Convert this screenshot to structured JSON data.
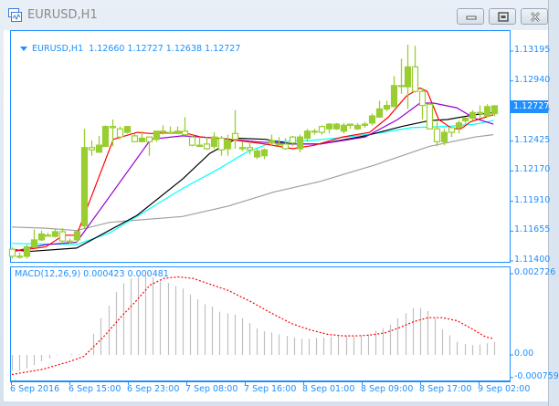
{
  "window": {
    "title": "EURUSD,H1",
    "buttons": [
      "minimize",
      "restore",
      "close"
    ]
  },
  "header": {
    "symbol": "EURUSD,H1",
    "ohlc": "1.12660 1.12727 1.12638 1.12727"
  },
  "colors": {
    "accent": "#1e90ff",
    "candle": "#9acd32",
    "ma_red": "#ff0000",
    "ma_purple": "#9400d3",
    "ma_black": "#000000",
    "ma_cyan": "#00ffff",
    "ma_gray": "#a0a0a0",
    "macd_hist": "#c0c0c0",
    "macd_signal": "#ff0000"
  },
  "chart_data": [
    {
      "type": "candlestick",
      "title": "EURUSD,H1",
      "ylim": [
        1.114,
        1.13195
      ],
      "y_ticks": [
        "1.13195",
        "1.12940",
        "1.12685",
        "1.12425",
        "1.12170",
        "1.11910",
        "1.11655",
        "1.11400"
      ],
      "current_price": "1.12727",
      "x_ticks": [
        "6 Sep 2016",
        "6 Sep 15:00",
        "6 Sep 23:00",
        "7 Sep 08:00",
        "7 Sep 16:00",
        "8 Sep 01:00",
        "8 Sep 09:00",
        "8 Sep 17:00",
        "9 Sep 02:00"
      ],
      "ohlc": [
        [
          1.115,
          1.1152,
          1.1142,
          1.1144
        ],
        [
          1.1144,
          1.1147,
          1.1142,
          1.1144
        ],
        [
          1.1144,
          1.1154,
          1.1142,
          1.1152
        ],
        [
          1.1152,
          1.1167,
          1.1151,
          1.1158
        ],
        [
          1.1158,
          1.1166,
          1.1157,
          1.1163
        ],
        [
          1.1162,
          1.1164,
          1.1161,
          1.1162
        ],
        [
          1.1161,
          1.1167,
          1.116,
          1.1165
        ],
        [
          1.1165,
          1.1168,
          1.1155,
          1.1157
        ],
        [
          1.1157,
          1.1159,
          1.1155,
          1.1157
        ],
        [
          1.1158,
          1.1166,
          1.1156,
          1.1165
        ],
        [
          1.117,
          1.1253,
          1.1168,
          1.1237
        ],
        [
          1.1237,
          1.1243,
          1.123,
          1.1235
        ],
        [
          1.1233,
          1.1247,
          1.1233,
          1.1239
        ],
        [
          1.1238,
          1.1256,
          1.1238,
          1.1255
        ],
        [
          1.1255,
          1.1261,
          1.1238,
          1.1254
        ],
        [
          1.1253,
          1.1255,
          1.1244,
          1.1246
        ],
        [
          1.125,
          1.1255,
          1.1249,
          1.1255
        ],
        [
          1.1247,
          1.1249,
          1.1242,
          1.1242
        ],
        [
          1.1242,
          1.1251,
          1.1242,
          1.1245
        ],
        [
          1.1246,
          1.1246,
          1.123,
          1.1242
        ],
        [
          1.1244,
          1.1251,
          1.1242,
          1.1251
        ],
        [
          1.125,
          1.1256,
          1.1248,
          1.1251
        ],
        [
          1.125,
          1.1255,
          1.1249,
          1.1249
        ],
        [
          1.1249,
          1.1255,
          1.1249,
          1.1251
        ],
        [
          1.1251,
          1.1263,
          1.1248,
          1.1248
        ],
        [
          1.1246,
          1.1247,
          1.1238,
          1.1239
        ],
        [
          1.1238,
          1.1246,
          1.1238,
          1.1239
        ],
        [
          1.124,
          1.1246,
          1.1235,
          1.1236
        ],
        [
          1.1238,
          1.125,
          1.1236,
          1.1246
        ],
        [
          1.1245,
          1.1247,
          1.123,
          1.1235
        ],
        [
          1.1236,
          1.1248,
          1.123,
          1.1243
        ],
        [
          1.1249,
          1.1269,
          1.1236,
          1.1244
        ],
        [
          1.1237,
          1.1242,
          1.1234,
          1.1236
        ],
        [
          1.1237,
          1.1242,
          1.1231,
          1.1235
        ],
        [
          1.1229,
          1.1236,
          1.1227,
          1.1234
        ],
        [
          1.123,
          1.1236,
          1.1227,
          1.1235
        ],
        [
          1.1241,
          1.1248,
          1.1238,
          1.1243
        ],
        [
          1.124,
          1.1246,
          1.1238,
          1.124
        ],
        [
          1.124,
          1.1245,
          1.1235,
          1.1236
        ],
        [
          1.1246,
          1.1247,
          1.1238,
          1.1241
        ],
        [
          1.1236,
          1.1248,
          1.1233,
          1.1246
        ],
        [
          1.1245,
          1.1253,
          1.1242,
          1.1251
        ],
        [
          1.1251,
          1.1253,
          1.1248,
          1.1251
        ],
        [
          1.1255,
          1.1256,
          1.1248,
          1.125
        ],
        [
          1.1253,
          1.1258,
          1.1249,
          1.1257
        ],
        [
          1.1253,
          1.1258,
          1.1252,
          1.1257
        ],
        [
          1.1251,
          1.1258,
          1.1249,
          1.1256
        ],
        [
          1.1257,
          1.1257,
          1.1253,
          1.1256
        ],
        [
          1.1253,
          1.1258,
          1.1252,
          1.1256
        ],
        [
          1.1256,
          1.1259,
          1.1254,
          1.1257
        ],
        [
          1.1258,
          1.1266,
          1.1256,
          1.1264
        ],
        [
          1.1263,
          1.1277,
          1.1263,
          1.127
        ],
        [
          1.127,
          1.1277,
          1.1268,
          1.1273
        ],
        [
          1.1272,
          1.1298,
          1.1272,
          1.129
        ],
        [
          1.129,
          1.1313,
          1.1283,
          1.129
        ],
        [
          1.1289,
          1.1325,
          1.127,
          1.1306
        ],
        [
          1.1306,
          1.1324,
          1.1284,
          1.1285
        ],
        [
          1.1285,
          1.1288,
          1.1261,
          1.1273
        ],
        [
          1.1274,
          1.1275,
          1.1253,
          1.1253
        ],
        [
          1.1253,
          1.1259,
          1.1238,
          1.1242
        ],
        [
          1.1242,
          1.1253,
          1.1239,
          1.125
        ],
        [
          1.1254,
          1.1255,
          1.1246,
          1.125
        ],
        [
          1.1254,
          1.126,
          1.1249,
          1.1258
        ],
        [
          1.126,
          1.1263,
          1.1257,
          1.1262
        ],
        [
          1.1262,
          1.1269,
          1.126,
          1.1267
        ],
        [
          1.1267,
          1.1273,
          1.1262,
          1.1266
        ],
        [
          1.1264,
          1.1274,
          1.1263,
          1.1272
        ],
        [
          1.1266,
          1.12727,
          1.12638,
          1.12727
        ]
      ],
      "moving_averages": [
        {
          "name": "ma-red",
          "color_key": "ma_red",
          "points": [
            [
              0,
              1.1148
            ],
            [
              4.7,
              1.1152
            ],
            [
              7.2,
              1.1162
            ],
            [
              9,
              1.1162
            ],
            [
              14.1,
              1.1244
            ],
            [
              17.4,
              1.125
            ],
            [
              19.3,
              1.1249
            ],
            [
              23.7,
              1.125
            ],
            [
              26.3,
              1.1246
            ],
            [
              30.1,
              1.1244
            ],
            [
              35.2,
              1.124
            ],
            [
              39,
              1.1236
            ],
            [
              42.1,
              1.1239
            ],
            [
              45.9,
              1.1246
            ],
            [
              49.7,
              1.125
            ],
            [
              52.3,
              1.1263
            ],
            [
              54.8,
              1.1281
            ],
            [
              56.7,
              1.1288
            ],
            [
              57.7,
              1.1285
            ],
            [
              59.3,
              1.1261
            ],
            [
              61.2,
              1.1253
            ],
            [
              62.4,
              1.1253
            ],
            [
              63.7,
              1.1259
            ],
            [
              66.9,
              1.1265
            ]
          ]
        },
        {
          "name": "ma-purple",
          "color_key": "ma_purple",
          "points": [
            [
              0,
              1.1148
            ],
            [
              4.7,
              1.1154
            ],
            [
              9,
              1.1156
            ],
            [
              19.3,
              1.1244
            ],
            [
              23.7,
              1.1247
            ],
            [
              28.8,
              1.1245
            ],
            [
              33.9,
              1.1242
            ],
            [
              39,
              1.124
            ],
            [
              42.8,
              1.124
            ],
            [
              49.1,
              1.1246
            ],
            [
              53.6,
              1.1261
            ],
            [
              56.7,
              1.1275
            ],
            [
              58.6,
              1.1275
            ],
            [
              61.8,
              1.1271
            ],
            [
              64.3,
              1.1262
            ],
            [
              66.9,
              1.1257
            ]
          ]
        },
        {
          "name": "ma-black",
          "color_key": "ma_black",
          "points": [
            [
              0,
              1.115
            ],
            [
              2.2,
              1.1148
            ],
            [
              9,
              1.1151
            ],
            [
              17.4,
              1.1179
            ],
            [
              23.7,
              1.121
            ],
            [
              27.5,
              1.1232
            ],
            [
              31.3,
              1.1245
            ],
            [
              35.2,
              1.1244
            ],
            [
              39,
              1.124
            ],
            [
              42.8,
              1.124
            ],
            [
              49.1,
              1.1247
            ],
            [
              54.2,
              1.1255
            ],
            [
              58,
              1.126
            ],
            [
              60.5,
              1.1261
            ],
            [
              64.3,
              1.1265
            ],
            [
              66.9,
              1.1267
            ]
          ]
        },
        {
          "name": "ma-cyan",
          "color_key": "ma_cyan",
          "points": [
            [
              0,
              1.1155
            ],
            [
              9,
              1.1154
            ],
            [
              13.6,
              1.1164
            ],
            [
              18.7,
              1.1183
            ],
            [
              23.7,
              1.1202
            ],
            [
              28.8,
              1.1219
            ],
            [
              32.6,
              1.1233
            ],
            [
              36.4,
              1.1242
            ],
            [
              41.5,
              1.1243
            ],
            [
              46.6,
              1.1246
            ],
            [
              51.6,
              1.125
            ],
            [
              55.5,
              1.1254
            ],
            [
              60.5,
              1.1255
            ],
            [
              64.3,
              1.1257
            ],
            [
              66.9,
              1.126
            ]
          ]
        },
        {
          "name": "ma-gray",
          "color_key": "ma_gray",
          "points": [
            [
              0,
              1.1169
            ],
            [
              4.7,
              1.1168
            ],
            [
              9,
              1.1166
            ],
            [
              13.6,
              1.1173
            ],
            [
              23.7,
              1.1178
            ],
            [
              30.1,
              1.1187
            ],
            [
              36.4,
              1.1199
            ],
            [
              42.8,
              1.1208
            ],
            [
              50.4,
              1.1222
            ],
            [
              54.2,
              1.123
            ],
            [
              58,
              1.1238
            ],
            [
              64.3,
              1.1246
            ],
            [
              66.9,
              1.1248
            ]
          ]
        }
      ]
    },
    {
      "type": "bar",
      "title": "MACD(12,26,9) 0.000423 0.000481",
      "ylim": [
        -0.000759,
        0.002726
      ],
      "y_ticks": [
        "0.002726",
        "0.00",
        "-0.000759"
      ],
      "histogram": [
        -0.00053,
        -0.00053,
        -0.00045,
        -0.00034,
        -0.00022,
        -0.00012,
        -2e-05,
        0,
        3e-05,
        3e-05,
        6e-05,
        0.00071,
        0.00123,
        0.00165,
        0.00211,
        0.00241,
        0.00257,
        0.00262,
        0.00264,
        0.0026,
        0.00246,
        0.00241,
        0.00231,
        0.00223,
        0.00203,
        0.00186,
        0.0017,
        0.00162,
        0.00145,
        0.0014,
        0.00135,
        0.00123,
        0.00107,
        0.00089,
        0.00079,
        0.00076,
        0.00069,
        0.00064,
        0.00059,
        0.00054,
        0.00054,
        0.00057,
        0.00059,
        0.00061,
        0.00064,
        0.00064,
        0.00061,
        0.00064,
        0.00069,
        0.00081,
        0.00089,
        0.00101,
        0.00123,
        0.0014,
        0.00158,
        0.00158,
        0.00147,
        0.00123,
        0.00086,
        0.00066,
        0.00044,
        0.00037,
        0.00033,
        0.00035,
        0.00039,
        0.00044
      ],
      "signal": [
        [
          0,
          -0.00066
        ],
        [
          4.2,
          -0.00048
        ],
        [
          7.8,
          -0.00022
        ],
        [
          9.7,
          -5e-05
        ],
        [
          12.3,
          0.00059
        ],
        [
          14.8,
          0.0013
        ],
        [
          16.7,
          0.0018
        ],
        [
          18.6,
          0.00234
        ],
        [
          20.5,
          0.00257
        ],
        [
          22.4,
          0.00262
        ],
        [
          24.4,
          0.00257
        ],
        [
          26.3,
          0.00241
        ],
        [
          29.2,
          0.00216
        ],
        [
          32.1,
          0.0018
        ],
        [
          35,
          0.0014
        ],
        [
          37.8,
          0.00104
        ],
        [
          40.2,
          0.00084
        ],
        [
          42.6,
          0.00069
        ],
        [
          44.6,
          0.00064
        ],
        [
          46.5,
          0.00064
        ],
        [
          48.4,
          0.00067
        ],
        [
          50.3,
          0.00074
        ],
        [
          52.3,
          0.00092
        ],
        [
          54.2,
          0.00112
        ],
        [
          56.1,
          0.00125
        ],
        [
          58,
          0.00125
        ],
        [
          60,
          0.00115
        ],
        [
          61.9,
          0.00089
        ],
        [
          63.8,
          0.00061
        ],
        [
          65,
          0.00054
        ]
      ]
    }
  ]
}
